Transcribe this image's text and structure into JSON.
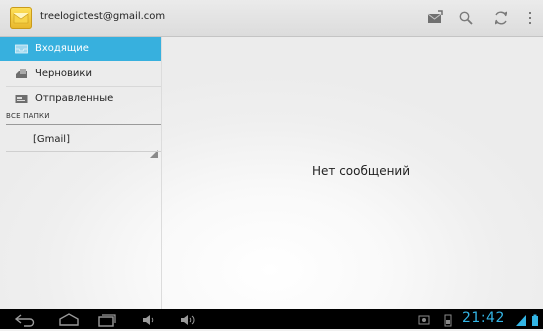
{
  "account": {
    "email": "treelogictest@gmail.com"
  },
  "actionbar": {
    "icons": [
      "compose-icon",
      "search-icon",
      "refresh-icon",
      "overflow-menu-icon"
    ]
  },
  "sidebar": {
    "items": [
      {
        "label": "Входящие",
        "icon": "inbox-icon",
        "active": true
      },
      {
        "label": "Черновики",
        "icon": "drafts-icon",
        "active": false
      },
      {
        "label": "Отправленные",
        "icon": "sent-icon",
        "active": false
      }
    ],
    "section_header": "ВСЕ ПАПКИ",
    "folders": [
      {
        "label": "[Gmail]"
      }
    ]
  },
  "main": {
    "empty_text": "Нет сообщений"
  },
  "system_bar": {
    "time": "21:42"
  },
  "colors": {
    "accent": "#37b0de",
    "clock": "#33b5e5"
  }
}
